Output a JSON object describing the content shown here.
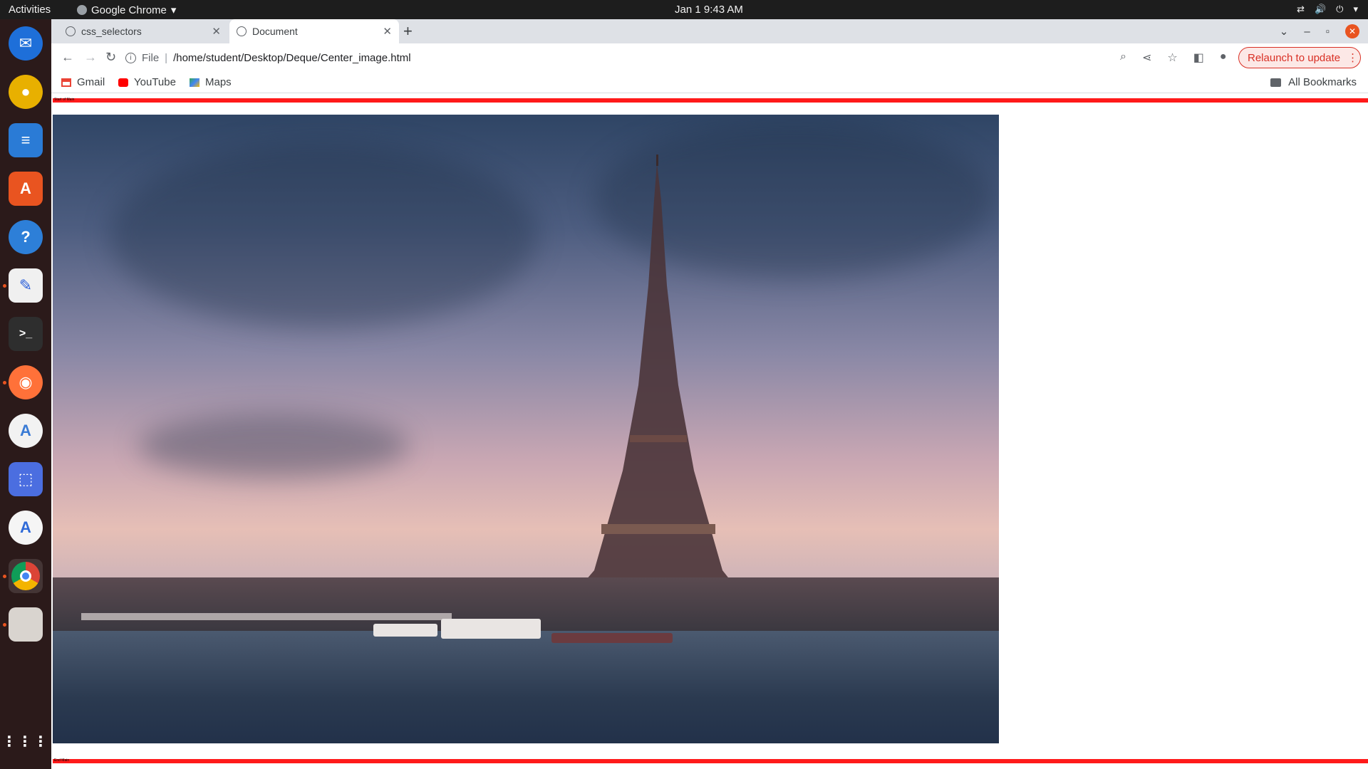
{
  "topbar": {
    "activities": "Activities",
    "app_name": "Google Chrome",
    "clock": "Jan 1  9:43 AM"
  },
  "dock": {
    "apps": [
      "thunderbird-icon",
      "rhythmbox-icon",
      "libreoffice-writer-icon",
      "app-center-icon",
      "help-icon",
      "text-editor-icon",
      "terminal-icon",
      "firefox-icon",
      "android-studio-icon",
      "screenshot-icon",
      "software-icon",
      "chrome-icon",
      "files-icon",
      "show-apps-icon"
    ]
  },
  "tabs": [
    {
      "title": "css_selectors"
    },
    {
      "title": "Document"
    }
  ],
  "toolbar": {
    "scheme": "File",
    "url": "/home/student/Desktop/Deque/Center_image.html",
    "relaunch": "Relaunch to update"
  },
  "bookmarks": {
    "items": [
      "Gmail",
      "YouTube",
      "Maps"
    ],
    "all": "All Bookmarks"
  },
  "page": {
    "top_rule_label": "Start of Main",
    "bottom_rule_label": "End Main"
  },
  "colors": {
    "rule": "#ff1a1a",
    "relaunch": "#d93025",
    "accent": "#e95420"
  }
}
